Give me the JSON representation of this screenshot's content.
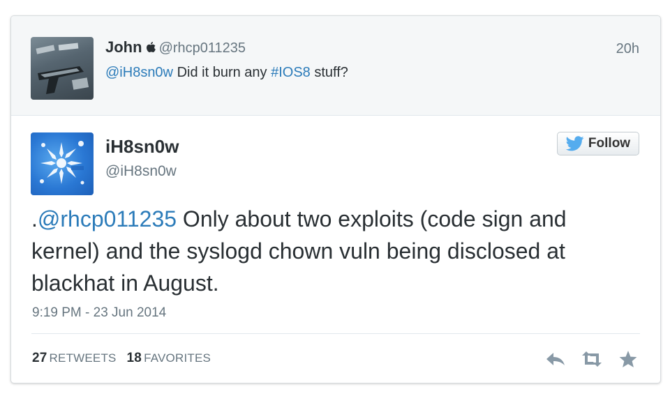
{
  "parent_tweet": {
    "name": "John",
    "apple_icon": "apple-icon",
    "handle": "@rhcp011235",
    "time": "20h",
    "mention": "@iH8sn0w",
    "text_middle": " Did it burn any ",
    "hashtag": "#IOS8",
    "text_end": " stuff?"
  },
  "main_tweet": {
    "name": "iH8sn0w",
    "handle": "@iH8sn0w",
    "follow_label": "Follow",
    "text_prefix": ".",
    "mention": "@rhcp011235",
    "text_body": " Only about two exploits (code sign and kernel) and the syslogd chown vuln being disclosed at blackhat in August.",
    "timestamp": "9:19 PM - 23 Jun 2014"
  },
  "stats": {
    "retweets_count": "27",
    "retweets_label": "RETWEETS",
    "favorites_count": "18",
    "favorites_label": "FAVORITES"
  },
  "actions": [
    "reply-icon",
    "retweet-icon",
    "favorite-star-icon"
  ],
  "colors": {
    "link": "#2b7bb9",
    "text": "#292f33",
    "muted": "#66757f",
    "twitter_bird": "#55acee"
  }
}
